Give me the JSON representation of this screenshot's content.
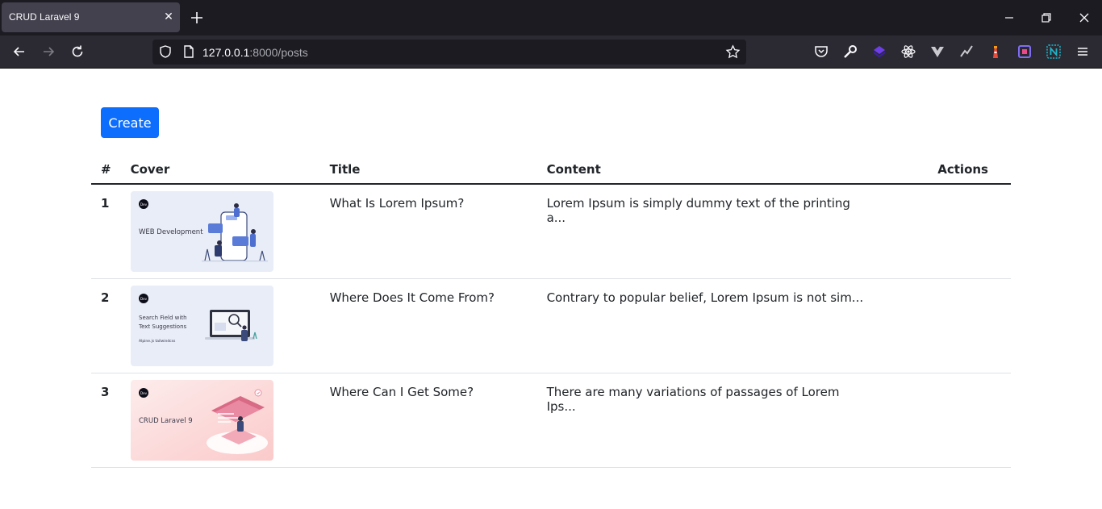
{
  "browser": {
    "tab_title": "CRUD Laravel 9",
    "url_host": "127.0.0.1",
    "url_rest": ":8000/posts"
  },
  "page": {
    "create_label": "Create",
    "columns": [
      "#",
      "Cover",
      "Title",
      "Content",
      "Actions"
    ],
    "rows": [
      {
        "num": "1",
        "title": "What Is Lorem Ipsum?",
        "content": "Lorem Ipsum is simply dummy text of the printing a...",
        "cover": {
          "badge": "Dev",
          "heading": "WEB Development",
          "subheading": "",
          "tags": "",
          "theme": "#e9edf7"
        }
      },
      {
        "num": "2",
        "title": "Where Does It Come From?",
        "content": "Contrary to popular belief, Lorem Ipsum is not sim...",
        "cover": {
          "badge": "Dev",
          "heading": "Search Field with",
          "subheading": "Text Suggestions",
          "tags": "Alpine.js  tailwindcss",
          "theme": "#e9edf7"
        }
      },
      {
        "num": "3",
        "title": "Where Can I Get Some?",
        "content": "There are many variations of passages of Lorem Ips...",
        "cover": {
          "badge": "Dev",
          "heading": "CRUD Laravel 9",
          "subheading": "",
          "tags": "",
          "theme": "#fde4e4"
        }
      }
    ]
  },
  "colors": {
    "primary": "#0d6efd",
    "chrome_dark": "#1c1b22",
    "chrome_mid": "#2b2a33"
  }
}
